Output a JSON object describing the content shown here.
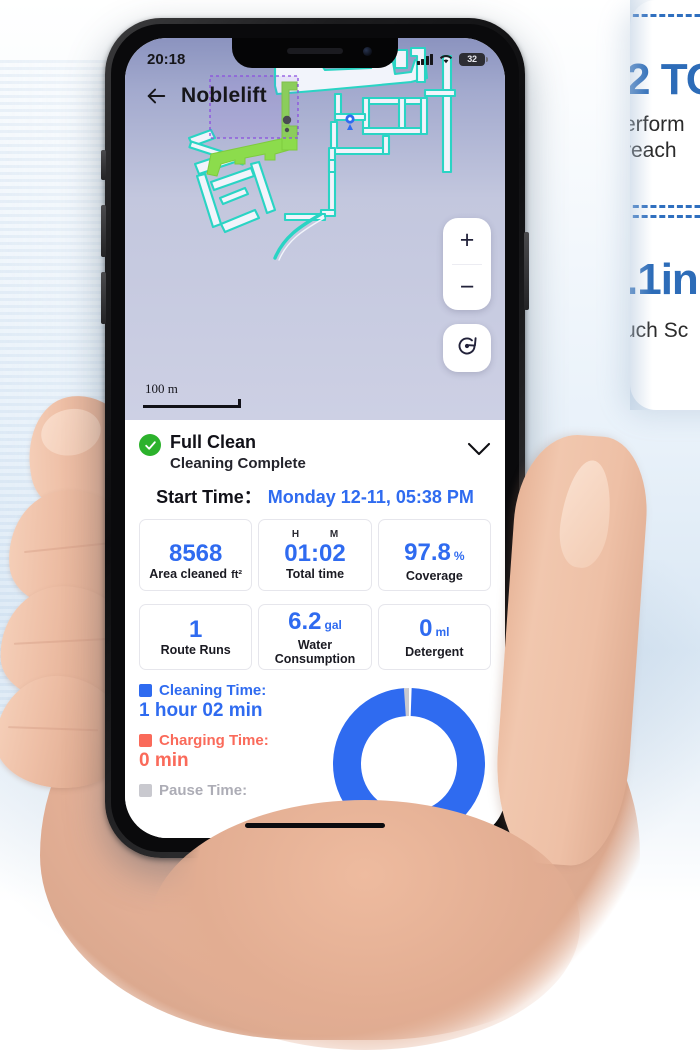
{
  "background": {
    "card": {
      "heading_1": "2 TO",
      "body_1_line_1": "erform",
      "body_1_line_2": "reach",
      "heading_2": ".1in",
      "body_2": "uch Sc"
    }
  },
  "phone": {
    "status_bar": {
      "time": "20:18",
      "signal_icon": "cellular-signal-icon",
      "wifi_icon": "wifi-icon",
      "battery_level": "32"
    },
    "home_indicator": "home-indicator"
  },
  "appbar": {
    "back_icon": "back-arrow-icon",
    "title": "Noblelift"
  },
  "map": {
    "scale_label": "100 m",
    "zoom_in_label": "+",
    "zoom_out_label": "−",
    "recenter_icon": "recenter-icon",
    "colors": {
      "background_top": "#8b93bf",
      "background_bottom": "#cdd0e4",
      "wall_outline": "#2ad4c4",
      "wall_fill": "#f2f4fb",
      "cleaned_area": "#8cdc4c",
      "selection_box": "#8a4ddf",
      "robot_marker": "#4a4a52",
      "location_marker": "#2f6bf0"
    }
  },
  "panel": {
    "status": {
      "icon": "check-circle-icon",
      "title": "Full Clean",
      "subtitle": "Cleaning Complete",
      "expand_icon": "chevron-down-icon"
    },
    "start_time": {
      "label": "Start Time：",
      "value": "Monday 12-11, 05:38 PM"
    },
    "stats": [
      {
        "value": "8568",
        "label": "Area cleaned",
        "unit": "ft²",
        "top_label": ""
      },
      {
        "value": "01:02",
        "label": "Total time",
        "unit": "",
        "top_label": "H        M"
      },
      {
        "value": "97.8",
        "label": "Coverage",
        "unit": "%",
        "top_label": ""
      },
      {
        "value": "1",
        "label": "Route Runs",
        "unit": "",
        "top_label": ""
      },
      {
        "value": "6.2",
        "label": "Water Consumption",
        "unit": "gal",
        "top_label": ""
      },
      {
        "value": "0",
        "label": "Detergent",
        "unit": "ml",
        "top_label": ""
      }
    ],
    "legend": [
      {
        "name": "Cleaning Time:",
        "value": "1 hour 02 min",
        "color": "#2f6bf0"
      },
      {
        "name": "Charging Time:",
        "value": "0 min",
        "color": "#fa6a5a"
      },
      {
        "name": "Pause Time:",
        "value": "",
        "color": "#c9c9cf"
      }
    ]
  },
  "chart_data": {
    "type": "pie",
    "title": "Time breakdown",
    "labels": [
      "Cleaning Time",
      "Charging Time",
      "Pause Time"
    ],
    "values": [
      98.4,
      0,
      1.6
    ],
    "colors": [
      "#2f6bf0",
      "#fa6a5a",
      "#c9c9cf"
    ],
    "legend_position": "left",
    "donut": true,
    "inner_radius_ratio": 0.62
  }
}
